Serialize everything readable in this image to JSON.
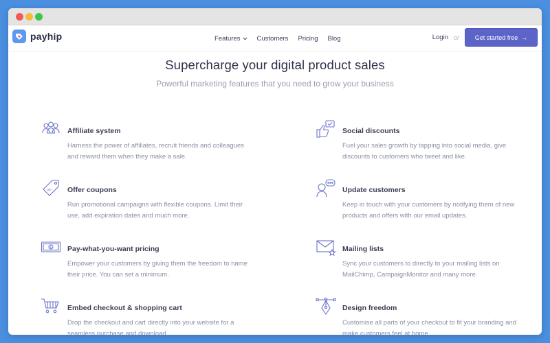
{
  "brand": {
    "name": "payhip"
  },
  "nav": {
    "links": [
      {
        "label": "Features",
        "has_dropdown": true
      },
      {
        "label": "Customers"
      },
      {
        "label": "Pricing"
      },
      {
        "label": "Blog"
      }
    ],
    "login": "Login",
    "or": "or",
    "cta": "Get started free",
    "cta_arrow": "→"
  },
  "hero": {
    "headline": "Supercharge your digital product sales",
    "subheadline": "Powerful marketing features that you need to grow your business"
  },
  "features": [
    {
      "title": "Affiliate system",
      "description": "Harness the power of affiliates, recruit friends and colleagues and reward them when they make a sale.",
      "icon": "people-icon"
    },
    {
      "title": "Social discounts",
      "description": "Fuel your sales growth by tapping into social media, give discounts to customers who tweet and like.",
      "icon": "thumbs-up-icon"
    },
    {
      "title": "Offer coupons",
      "description": "Run promotional campaigns with flexible coupons. Limit their use, add expiration dates and much more.",
      "icon": "coupon-tag-icon"
    },
    {
      "title": "Update customers",
      "description": "Keep in touch with your customers by notifying them of new products and offers with our email updates.",
      "icon": "chat-person-icon"
    },
    {
      "title": "Pay-what-you-want pricing",
      "description": "Empower your customers by giving them the freedom to name their price. You can set a minimum.",
      "icon": "banknote-icon"
    },
    {
      "title": "Mailing lists",
      "description": "Sync your customers to directly to your mailing lists on MailChimp, CampaignMonitor and many more.",
      "icon": "envelope-star-icon"
    },
    {
      "title": "Embed checkout & shopping cart",
      "description": "Drop the checkout and cart directly into your website for a seamless purchase and download.",
      "icon": "shopping-cart-icon"
    },
    {
      "title": "Design freedom",
      "description": "Customise all parts of your checkout to fit your branding and make customers feel at home.",
      "icon": "pen-tool-icon"
    }
  ],
  "colors": {
    "accent": "#5c64c8",
    "icon_stroke": "#6b73c9",
    "background": "#4a8fe0"
  }
}
